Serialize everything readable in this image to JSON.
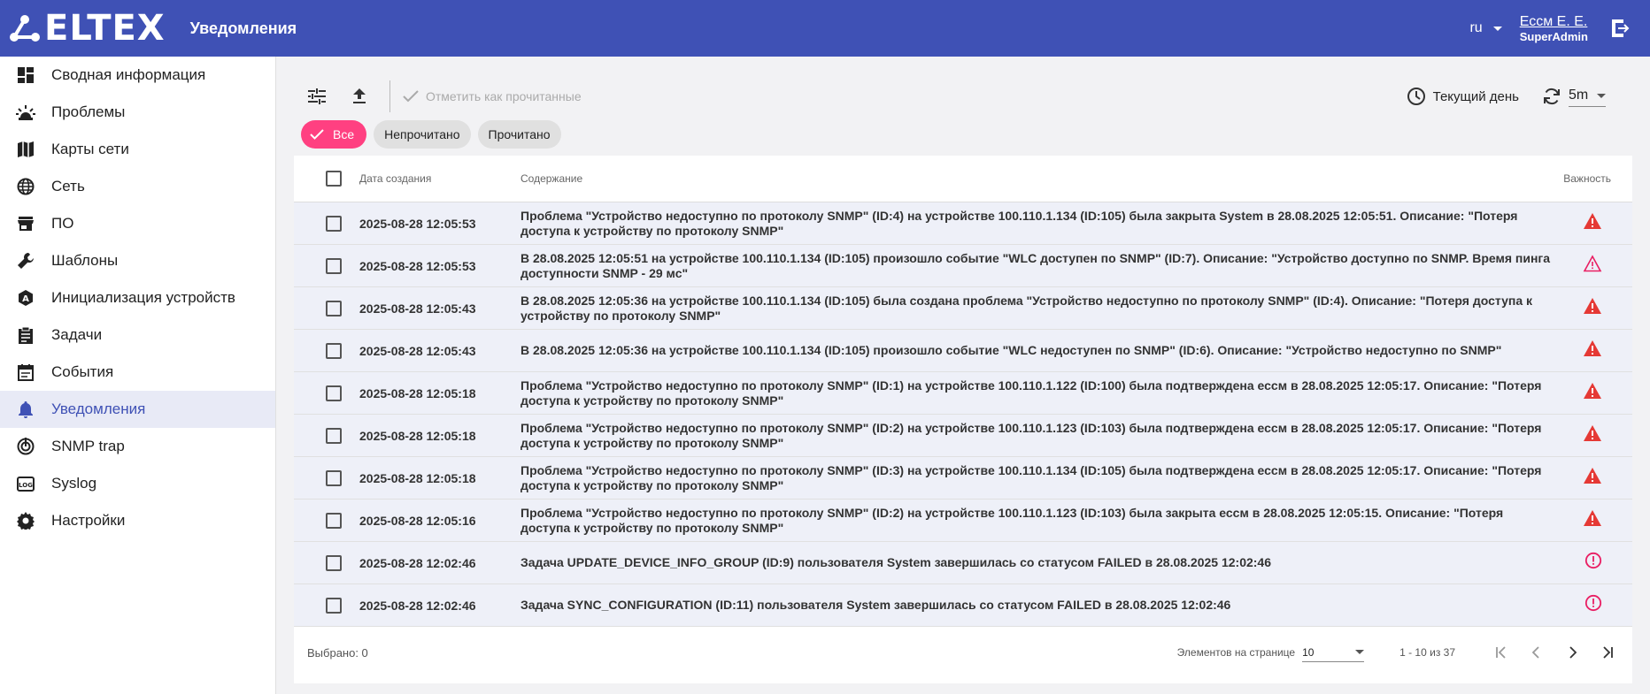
{
  "header": {
    "logo_text": "ELTEX",
    "title": "Уведомления",
    "language": "ru",
    "user_name": "Ессм Е. Е.",
    "user_role": "SuperAdmin"
  },
  "sidebar": {
    "items": [
      {
        "label": "Сводная информация",
        "icon": "dashboard-icon"
      },
      {
        "label": "Проблемы",
        "icon": "alarm-light-icon"
      },
      {
        "label": "Карты сети",
        "icon": "map-icon"
      },
      {
        "label": "Сеть",
        "icon": "globe-icon"
      },
      {
        "label": "ПО",
        "icon": "store-icon"
      },
      {
        "label": "Шаблоны",
        "icon": "wrench-icon"
      },
      {
        "label": "Инициализация устройств",
        "icon": "auto-init-icon"
      },
      {
        "label": "Задачи",
        "icon": "clipboard-icon"
      },
      {
        "label": "События",
        "icon": "calendar-icon"
      },
      {
        "label": "Уведомления",
        "icon": "bell-icon"
      },
      {
        "label": "SNMP trap",
        "icon": "signal-icon"
      },
      {
        "label": "Syslog",
        "icon": "log-icon"
      },
      {
        "label": "Настройки",
        "icon": "gear-icon"
      }
    ]
  },
  "toolbar": {
    "mark_read_label": "Отметить как прочитанные",
    "period_label": "Текущий день",
    "refresh_value": "5m"
  },
  "filters": {
    "all": "Все",
    "unread": "Непрочитано",
    "read": "Прочитано"
  },
  "table": {
    "headers": {
      "date": "Дата создания",
      "content": "Содержание",
      "severity": "Важность"
    },
    "rows": [
      {
        "date": "2025-08-28 12:05:53",
        "content": "Проблема \"Устройство недоступно по протоколу SNMP\" (ID:4) на устройстве 100.110.1.134 (ID:105) была закрыта System в 28.08.2025 12:05:51. Описание: \"Потеря доступа к устройству по протоколу SNMP\"",
        "severity": "critical"
      },
      {
        "date": "2025-08-28 12:05:53",
        "content": "В 28.08.2025 12:05:51 на устройстве 100.110.1.134 (ID:105) произошло событие \"WLC доступен по SNMP\" (ID:7). Описание: \"Устройство доступно по SNMP. Время пинга доступности SNMP - 29 мс\"",
        "severity": "warning-outline"
      },
      {
        "date": "2025-08-28 12:05:43",
        "content": "В 28.08.2025 12:05:36 на устройстве 100.110.1.134 (ID:105) была создана проблема \"Устройство недоступно по протоколу SNMP\" (ID:4). Описание: \"Потеря доступа к устройству по протоколу SNMP\"",
        "severity": "critical"
      },
      {
        "date": "2025-08-28 12:05:43",
        "content": "В 28.08.2025 12:05:36 на устройстве 100.110.1.134 (ID:105) произошло событие \"WLC недоступен по SNMP\" (ID:6). Описание: \"Устройство недоступно по SNMP\"",
        "severity": "critical"
      },
      {
        "date": "2025-08-28 12:05:18",
        "content": "Проблема \"Устройство недоступно по протоколу SNMP\" (ID:1) на устройстве 100.110.1.122 (ID:100) была подтверждена ессм в 28.08.2025 12:05:17. Описание: \"Потеря доступа к устройству по протоколу SNMP\"",
        "severity": "critical"
      },
      {
        "date": "2025-08-28 12:05:18",
        "content": "Проблема \"Устройство недоступно по протоколу SNMP\" (ID:2) на устройстве 100.110.1.123 (ID:103) была подтверждена ессм в 28.08.2025 12:05:17. Описание: \"Потеря доступа к устройству по протоколу SNMP\"",
        "severity": "critical"
      },
      {
        "date": "2025-08-28 12:05:18",
        "content": "Проблема \"Устройство недоступно по протоколу SNMP\" (ID:3) на устройстве 100.110.1.134 (ID:105) была подтверждена ессм в 28.08.2025 12:05:17. Описание: \"Потеря доступа к устройству по протоколу SNMP\"",
        "severity": "critical"
      },
      {
        "date": "2025-08-28 12:05:16",
        "content": "Проблема \"Устройство недоступно по протоколу SNMP\" (ID:2) на устройстве 100.110.1.123 (ID:103) была закрыта ессм в 28.08.2025 12:05:15. Описание: \"Потеря доступа к устройству по протоколу SNMP\"",
        "severity": "critical"
      },
      {
        "date": "2025-08-28 12:02:46",
        "content": "Задача UPDATE_DEVICE_INFO_GROUP (ID:9) пользователя System завершилась со статусом FAILED в 28.08.2025 12:02:46",
        "severity": "error-circle"
      },
      {
        "date": "2025-08-28 12:02:46",
        "content": "Задача SYNC_CONFIGURATION (ID:11) пользователя System завершилась со статусом FAILED в 28.08.2025 12:02:46",
        "severity": "error-circle"
      }
    ]
  },
  "footer": {
    "selected": "Выбрано: 0",
    "per_page_label": "Элементов на странице",
    "per_page_value": "10",
    "range": "1 - 10 из 37"
  },
  "colors": {
    "header_bg": "#3f51b5",
    "accent_pink": "#ff4081",
    "severity_red": "#e53935",
    "severity_pink": "#e91e63"
  }
}
